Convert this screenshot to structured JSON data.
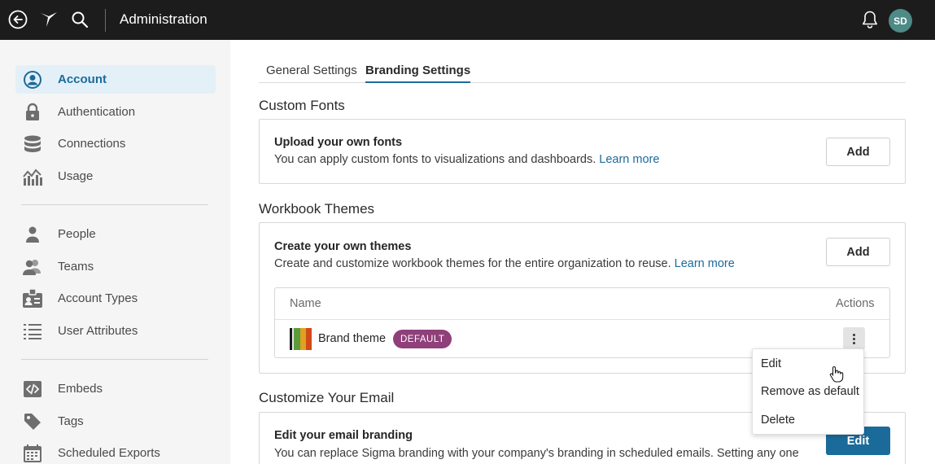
{
  "header": {
    "title": "Administration",
    "avatar_initials": "SD",
    "icons": [
      "back-icon",
      "sigma-logo",
      "search-icon",
      "bell-icon"
    ]
  },
  "sidebar": {
    "items": [
      {
        "label": "Account",
        "icon": "account-icon",
        "active": true
      },
      {
        "label": "Authentication",
        "icon": "lock-icon"
      },
      {
        "label": "Connections",
        "icon": "database-icon"
      },
      {
        "label": "Usage",
        "icon": "usage-chart-icon"
      },
      {
        "label": "People",
        "icon": "person-icon"
      },
      {
        "label": "Teams",
        "icon": "teams-icon"
      },
      {
        "label": "Account Types",
        "icon": "id-badge-icon"
      },
      {
        "label": "User Attributes",
        "icon": "list-icon"
      },
      {
        "label": "Embeds",
        "icon": "code-icon"
      },
      {
        "label": "Tags",
        "icon": "tag-icon"
      },
      {
        "label": "Scheduled Exports",
        "icon": "calendar-icon"
      }
    ]
  },
  "tabs": [
    {
      "label": "General Settings",
      "active": false
    },
    {
      "label": "Branding Settings",
      "active": true
    }
  ],
  "fonts": {
    "section_title": "Custom Fonts",
    "heading": "Upload your own fonts",
    "description": "You can apply custom fonts to visualizations and dashboards.",
    "link": "Learn more",
    "button": "Add"
  },
  "themes": {
    "section_title": "Workbook Themes",
    "heading": "Create your own themes",
    "description": "Create and customize workbook themes for the entire organization to reuse.",
    "link": "Learn more",
    "button": "Add",
    "table": {
      "col_name": "Name",
      "col_actions": "Actions",
      "rows": [
        {
          "name": "Brand theme",
          "badge": "DEFAULT",
          "swatch_colors": [
            "#1a1a1a",
            "#e8e8e8",
            "#5a9c3a",
            "#e0a020",
            "#d04a1a"
          ]
        }
      ]
    }
  },
  "menu": {
    "items": [
      "Edit",
      "Remove as default",
      "Delete"
    ]
  },
  "email": {
    "section_title": "Customize Your Email",
    "heading": "Edit your email branding",
    "description": "You can replace Sigma branding with your company's branding in scheduled emails. Setting any one",
    "button": "Edit"
  },
  "colors": {
    "accent": "#1b6b9a",
    "badge": "#8f3f79",
    "topbar": "#1c1c1c",
    "sidebar_bg": "#f5f5f5",
    "active_nav_bg": "#e4f0f8",
    "avatar": "#4e8a86"
  }
}
